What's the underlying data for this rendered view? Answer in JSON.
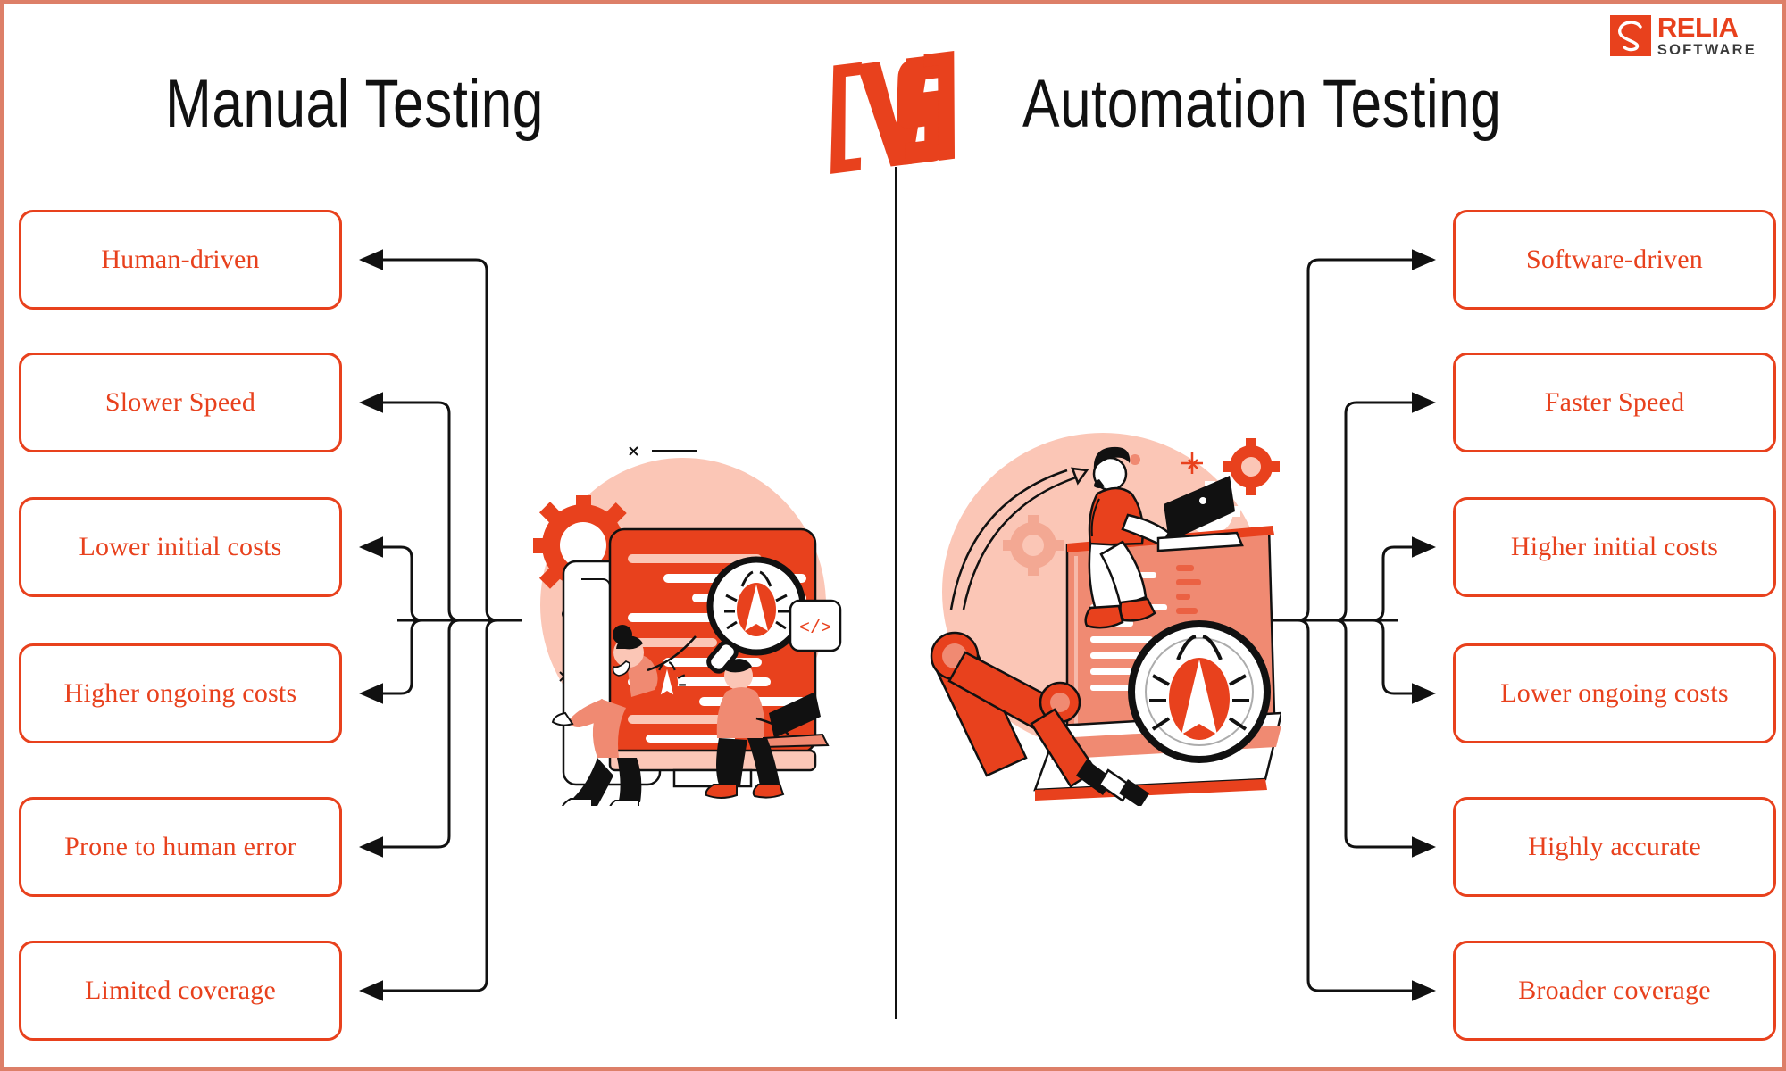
{
  "meta": {
    "frame_color": "#dd7f68",
    "accent_color": "#e8411d",
    "accent_light": "#f9b3a0",
    "accent_pale": "#fbd2c7",
    "line_color": "#111111",
    "background": "#ffffff"
  },
  "header": {
    "left_title": "Manual Testing",
    "right_title": "Automation Testing",
    "vs_label": "VS"
  },
  "logo": {
    "brand": "RELIA",
    "sub": "SOFTWARE",
    "mark_icon": "relia-s-mark-icon"
  },
  "left_column": {
    "heading": "Manual Testing",
    "items": [
      {
        "label": "Human-driven"
      },
      {
        "label": "Slower Speed"
      },
      {
        "label": "Lower initial costs"
      },
      {
        "label": "Higher ongoing costs"
      },
      {
        "label": "Prone to human error"
      },
      {
        "label": "Limited coverage"
      }
    ]
  },
  "right_column": {
    "heading": "Automation Testing",
    "items": [
      {
        "label": "Software-driven"
      },
      {
        "label": "Faster Speed"
      },
      {
        "label": "Higher initial costs"
      },
      {
        "label": "Lower ongoing costs"
      },
      {
        "label": "Highly accurate"
      },
      {
        "label": "Broader coverage"
      }
    ]
  },
  "illustrations": {
    "left": {
      "name": "manual-testing-illustration",
      "description": "Two people inspecting a monitor full of code with a magnifying glass and bugs, gear in background"
    },
    "right": {
      "name": "automation-testing-illustration",
      "description": "Robotic arm holding a magnifying glass over a laptop screen with code and a bug, a developer sits on top with a laptop, gears in background"
    }
  }
}
